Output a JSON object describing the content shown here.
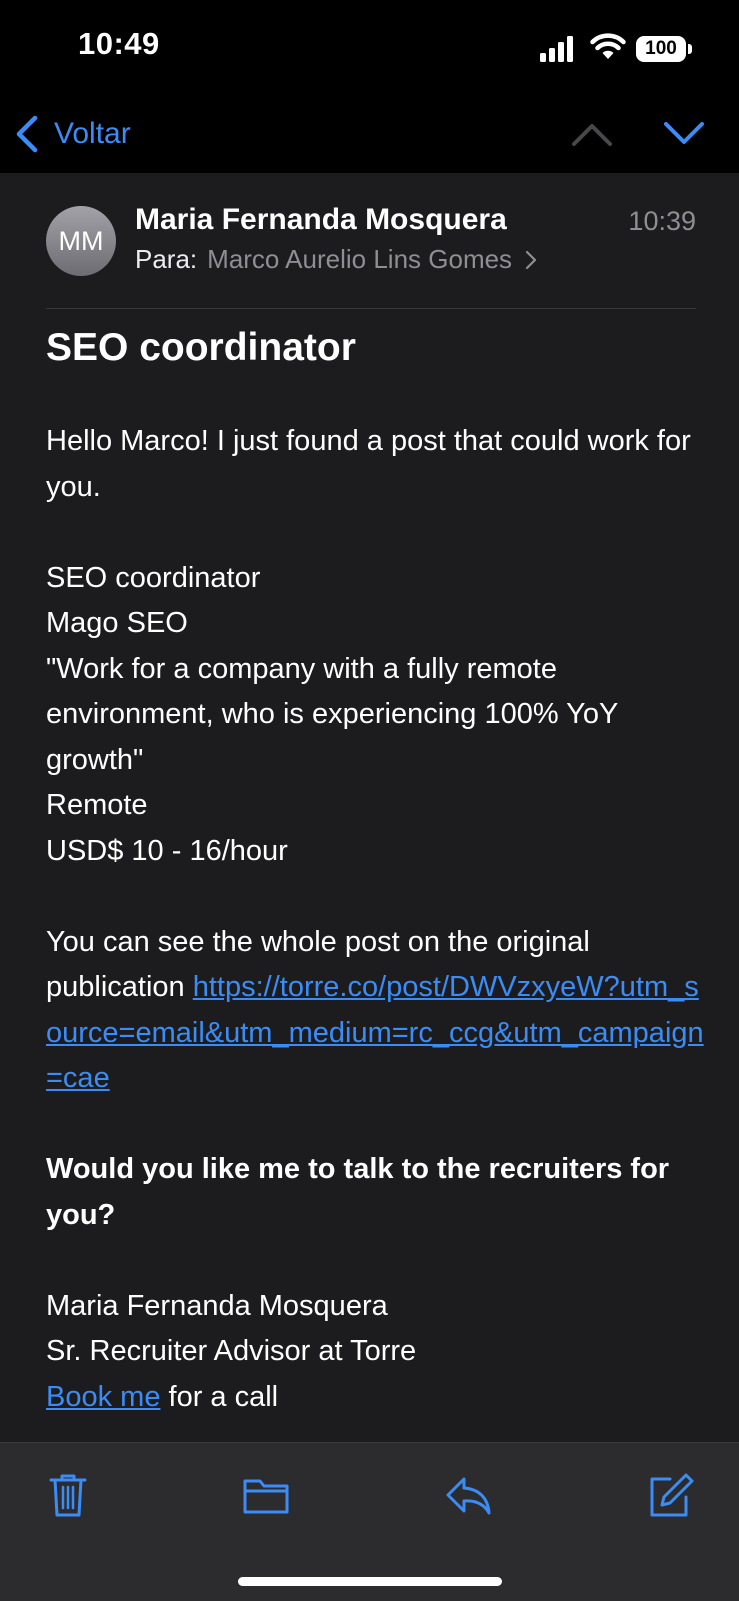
{
  "status_bar": {
    "time": "10:49",
    "battery": "100",
    "icons": [
      "cellular-signal-icon",
      "wifi-icon",
      "battery-icon"
    ]
  },
  "nav": {
    "back_label": "Voltar",
    "icons": [
      "chevron-left-icon",
      "chevron-up-icon",
      "chevron-down-icon"
    ]
  },
  "email": {
    "avatar_initials": "MM",
    "sender": "Maria Fernanda Mosquera",
    "time": "10:39",
    "to_label": "Para:",
    "to_value": "Marco Aurelio Lins Gomes",
    "subject": "SEO coordinator",
    "body": {
      "greeting": "Hello Marco! I just found a post that could work for you.",
      "job_title": "SEO coordinator",
      "company": "Mago SEO",
      "quote": "\"Work for a company with a fully remote environment, who is experiencing 100% YoY growth\"",
      "location": "Remote",
      "salary": "USD$ 10 - 16/hour",
      "see_post_prefix": "You can see the whole post on the original publication ",
      "post_link": "https://torre.co/post/DWVzxyeW?utm_source=email&utm_medium=rc_ccg&utm_campaign=cae",
      "question": "Would you like me to talk to the recruiters for you?",
      "signature_name": "Maria Fernanda Mosquera",
      "signature_role": "Sr. Recruiter Advisor at Torre",
      "book_link": "Book me",
      "book_suffix": " for a call"
    }
  },
  "toolbar": {
    "icons": [
      "trash-icon",
      "folder-icon",
      "reply-icon",
      "compose-icon"
    ]
  },
  "colors": {
    "accent": "#3b8cf5",
    "background": "#1c1c1e",
    "secondary_text": "#8e8e93"
  }
}
